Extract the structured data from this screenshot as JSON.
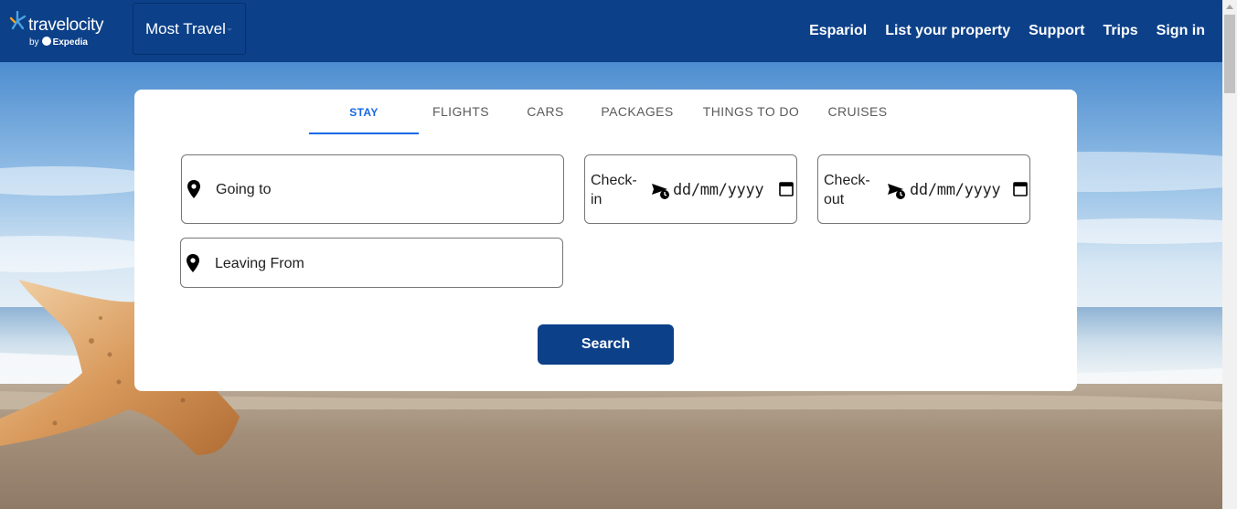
{
  "brand": {
    "name": "travelocity",
    "byline_prefix": "by",
    "byline_brand": "Expedia",
    "colors": {
      "primary": "#0c4089",
      "accent": "#1668e3"
    }
  },
  "header": {
    "dropdown_label": "Most Travel",
    "nav": [
      "Espariol",
      "List your property",
      "Support",
      "Trips",
      "Sign in"
    ]
  },
  "search": {
    "tabs": [
      "STAY",
      "FLIGHTS",
      "CARS",
      "PACKAGES",
      "THINGS TO DO",
      "CRUISES"
    ],
    "active_tab": "STAY",
    "going_to_placeholder": "Going to",
    "leaving_from_placeholder": "Leaving From",
    "checkin": {
      "label": "Check-in",
      "value": "dd/mm/yyyy",
      "icon": "calendar-icon"
    },
    "checkout": {
      "label": "Check-out",
      "value": "dd/mm/yyyy",
      "icon": "calendar-icon"
    },
    "submit_label": "Search"
  }
}
